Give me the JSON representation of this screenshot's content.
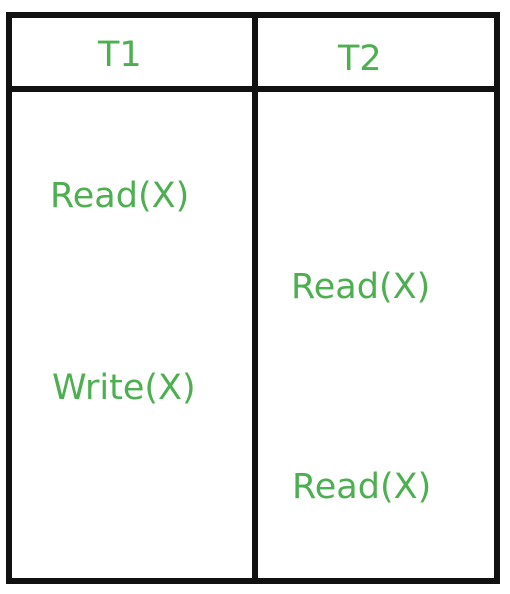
{
  "table": {
    "headers": [
      "T1",
      "T2"
    ],
    "t1_ops": [
      "Read(X)",
      "Write(X)"
    ],
    "t2_ops": [
      "Read(X)",
      "Read(X)"
    ]
  },
  "colors": {
    "text": "#4caf50",
    "border": "#111111",
    "background": "#ffffff"
  }
}
